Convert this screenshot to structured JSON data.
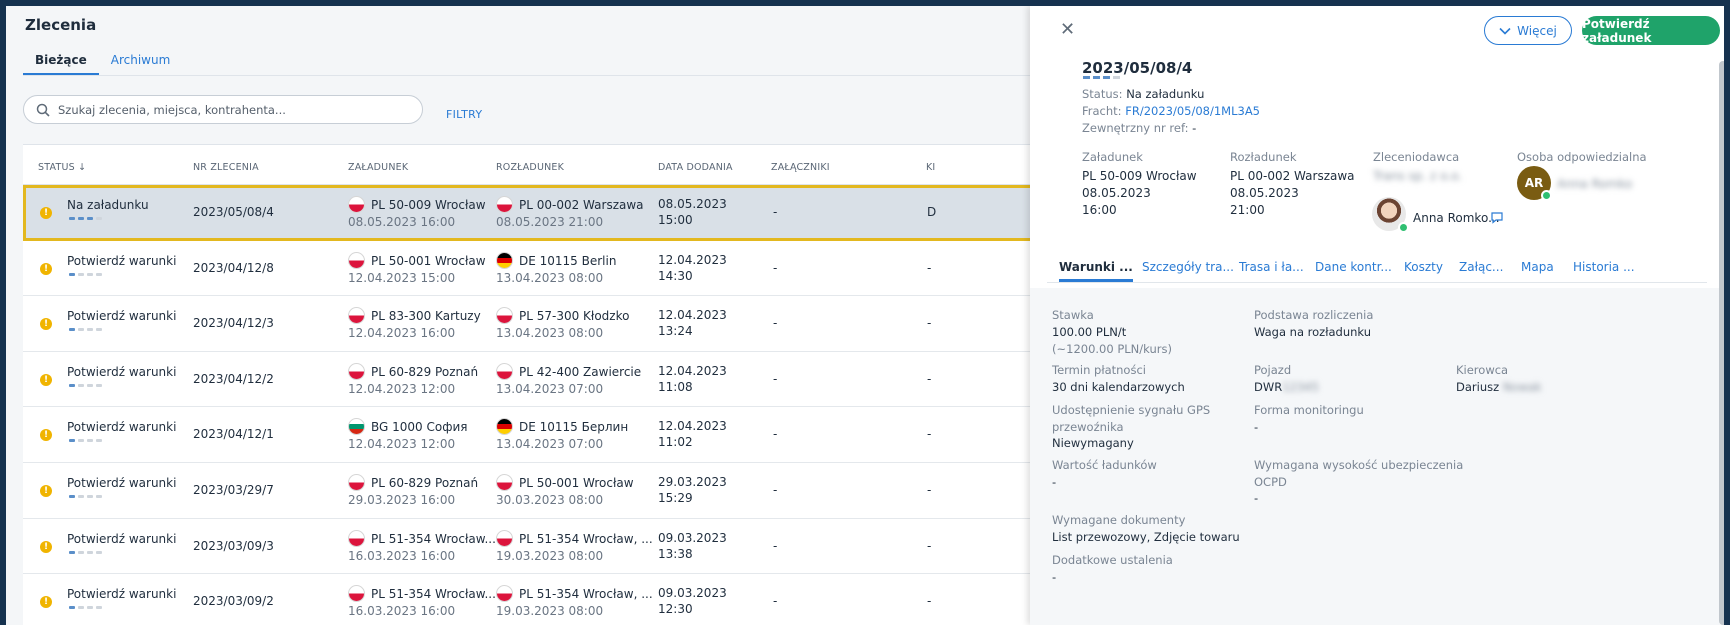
{
  "app": {
    "title": "Zlecenia",
    "tabs": [
      "Bieżące",
      "Archiwum"
    ]
  },
  "search": {
    "placeholder": "Szukaj zlecenia, miejsca, kontrahenta...",
    "filters_label": "FILTRY"
  },
  "table": {
    "headers": [
      "STATUS ↓",
      "NR ZLECENIA",
      "ZAŁADUNEK",
      "ROZŁADUNEK",
      "DATA DODANIA",
      "ZAŁĄCZNIKI",
      "KI"
    ],
    "rows": [
      {
        "status": "Na załadunku",
        "progress": 3,
        "nr": "2023/05/08/4",
        "load_flag": "pl",
        "load_place": "PL 50-009 Wrocław",
        "load_date": "08.05.2023 16:00",
        "unload_flag": "pl",
        "unload_place": "PL 00-002 Warszawa",
        "unload_date": "08.05.2023 21:00",
        "added_date": "08.05.2023",
        "added_time": "15:00",
        "attachments": "-",
        "extra": "D"
      },
      {
        "status": "Potwierdź warunki",
        "progress": 1,
        "nr": "2023/04/12/8",
        "load_flag": "pl",
        "load_place": "PL 50-001 Wrocław",
        "load_date": "12.04.2023 15:00",
        "unload_flag": "de",
        "unload_place": "DE 10115 Berlin",
        "unload_date": "13.04.2023 08:00",
        "added_date": "12.04.2023",
        "added_time": "14:30",
        "attachments": "-",
        "extra": "-"
      },
      {
        "status": "Potwierdź warunki",
        "progress": 1,
        "nr": "2023/04/12/3",
        "load_flag": "pl",
        "load_place": "PL 83-300 Kartuzy",
        "load_date": "12.04.2023 16:00",
        "unload_flag": "pl",
        "unload_place": "PL 57-300 Kłodzko",
        "unload_date": "13.04.2023 08:00",
        "added_date": "12.04.2023",
        "added_time": "13:24",
        "attachments": "-",
        "extra": "-"
      },
      {
        "status": "Potwierdź warunki",
        "progress": 1,
        "nr": "2023/04/12/2",
        "load_flag": "pl",
        "load_place": "PL 60-829 Poznań",
        "load_date": "12.04.2023 12:00",
        "unload_flag": "pl",
        "unload_place": "PL 42-400 Zawiercie",
        "unload_date": "13.04.2023 07:00",
        "added_date": "12.04.2023",
        "added_time": "11:08",
        "attachments": "-",
        "extra": "-"
      },
      {
        "status": "Potwierdź warunki",
        "progress": 1,
        "nr": "2023/04/12/1",
        "load_flag": "bg",
        "load_place": "BG 1000 София",
        "load_date": "12.04.2023 12:00",
        "unload_flag": "de",
        "unload_place": "DE 10115 Берлин",
        "unload_date": "13.04.2023 07:00",
        "added_date": "12.04.2023",
        "added_time": "11:02",
        "attachments": "-",
        "extra": "-"
      },
      {
        "status": "Potwierdź warunki",
        "progress": 1,
        "nr": "2023/03/29/7",
        "load_flag": "pl",
        "load_place": "PL 60-829 Poznań",
        "load_date": "29.03.2023 16:00",
        "unload_flag": "pl",
        "unload_place": "PL 50-001 Wrocław",
        "unload_date": "30.03.2023 08:00",
        "added_date": "29.03.2023",
        "added_time": "15:29",
        "attachments": "-",
        "extra": "-"
      },
      {
        "status": "Potwierdź warunki",
        "progress": 1,
        "nr": "2023/03/09/3",
        "load_flag": "pl",
        "load_place": "PL 51-354 Wrocław...",
        "load_date": "16.03.2023 16:00",
        "unload_flag": "pl",
        "unload_place": "PL 51-354 Wrocław, ...",
        "unload_date": "19.03.2023 08:00",
        "added_date": "09.03.2023",
        "added_time": "13:38",
        "attachments": "-",
        "extra": "-"
      },
      {
        "status": "Potwierdź warunki",
        "progress": 1,
        "nr": "2023/03/09/2",
        "load_flag": "pl",
        "load_place": "PL 51-354 Wrocław...",
        "load_date": "16.03.2023 16:00",
        "unload_flag": "pl",
        "unload_place": "PL 51-354 Wrocław, ...",
        "unload_date": "19.03.2023 08:00",
        "added_date": "09.03.2023",
        "added_time": "12:30",
        "attachments": "-",
        "extra": "-"
      }
    ]
  },
  "detail": {
    "more_label": "Więcej",
    "confirm_label": "Potwierdź załadunek",
    "order_no": "2023/05/08/4",
    "status_label": "Status:",
    "status_value": "Na załadunku",
    "freight_label": "Fracht:",
    "freight_value": "FR/2023/05/08/1ML3A5",
    "extref_label": "Zewnętrzny nr ref:",
    "extref_value": "-",
    "load_label": "Załadunek",
    "load_place": "PL 50-009 Wrocław",
    "load_date": "08.05.2023",
    "load_time": "16:00",
    "unload_label": "Rozładunek",
    "unload_place": "PL 00-002 Warszawa",
    "unload_date": "08.05.2023",
    "unload_time": "21:00",
    "client_label": "Zleceniodawca",
    "client_value": "Trans sp. z o.o.",
    "contact_name": "Anna Romko...",
    "owner_label": "Osoba odpowiedzialna",
    "owner_initials": "AR",
    "owner_name": "Anna Romko",
    "tabs": [
      "Warunki ...",
      "Szczegóły tra...",
      "Trasa i ła...",
      "Dane kontr...",
      "Koszty",
      "Załąc...",
      "Mapa",
      "Historia ..."
    ],
    "fields": {
      "rate_label": "Stawka",
      "rate_value": "100.00 PLN/t",
      "rate_note": "(~1200.00 PLN/kurs)",
      "basis_label": "Podstawa rozliczenia",
      "basis_value": "Waga na rozładunku",
      "payment_label": "Termin płatności",
      "payment_value": "30 dni kalendarzowych",
      "vehicle_label": "Pojazd",
      "vehicle_value": "DWR",
      "vehicle_hidden": "12345",
      "driver_label": "Kierowca",
      "driver_value": "Dariusz",
      "driver_hidden": "Nowak",
      "gps_label": "Udostępnienie sygnału GPS przewoźnika",
      "gps_value": "Niewymagany",
      "monitoring_label": "Forma monitoringu",
      "monitoring_value": "-",
      "cargo_label": "Wartość ładunków",
      "cargo_value": "-",
      "insurance_label": "Wymagana wysokość ubezpieczenia OCPD",
      "insurance_value": "-",
      "docs_label": "Wymagane dokumenty",
      "docs_value": "List przewozowy, Zdjęcie towaru",
      "extra_label": "Dodatkowe ustalenia",
      "extra_value": "-"
    }
  }
}
